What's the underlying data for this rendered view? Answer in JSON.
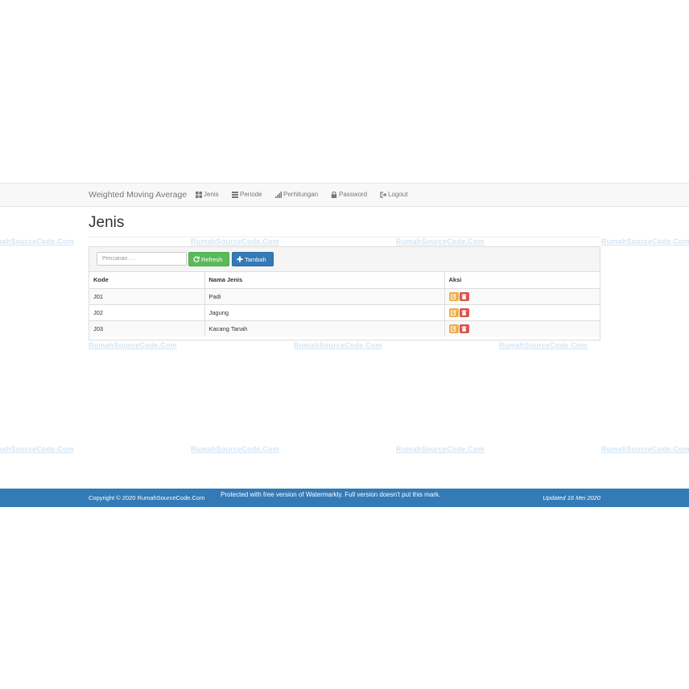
{
  "navbar": {
    "brand": "Weighted Moving Average",
    "items": [
      {
        "label": "Jenis",
        "icon": "th-large-icon"
      },
      {
        "label": "Periode",
        "icon": "list-icon"
      },
      {
        "label": "Perhitungan",
        "icon": "signal-icon"
      },
      {
        "label": "Password",
        "icon": "lock-icon"
      },
      {
        "label": "Logout",
        "icon": "sign-out-icon"
      }
    ]
  },
  "page": {
    "title": "Jenis"
  },
  "toolbar": {
    "search_placeholder": "Pencarian. . .",
    "refresh_label": "Refresh",
    "add_label": "Tambah"
  },
  "table": {
    "headers": [
      "Kode",
      "Nama Jenis",
      "Aksi"
    ],
    "rows": [
      {
        "kode": "J01",
        "nama": "Padi"
      },
      {
        "kode": "J02",
        "nama": "Jagung"
      },
      {
        "kode": "J03",
        "nama": "Kacang Tanah"
      }
    ]
  },
  "footer": {
    "copyright": "Copyright © 2020 RumahSourceCode.Com",
    "watermark_note": "Protected with free version of Watermarkly. Full version doesn't put this mark.",
    "updated": "Updated 16 Mei 2020"
  },
  "watermark": {
    "text": "RumahSourceCode.Com"
  },
  "colors": {
    "primary": "#337ab7",
    "success": "#5cb85c",
    "warning": "#f0ad4e",
    "danger": "#d9534f",
    "navbar_bg": "#f8f8f8"
  }
}
